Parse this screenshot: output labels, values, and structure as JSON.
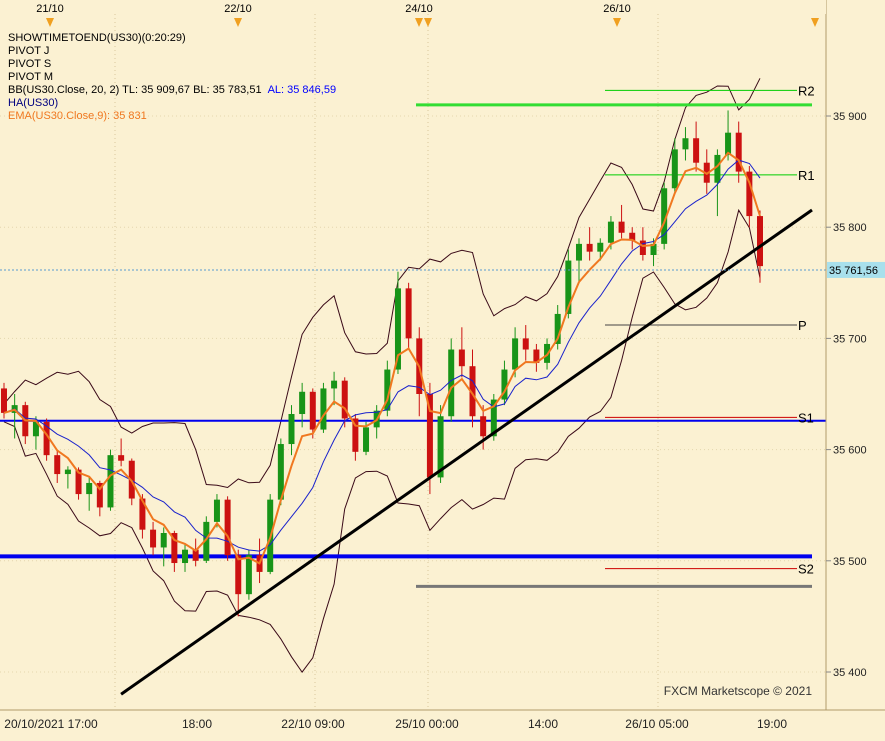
{
  "chart_data": {
    "type": "candlestick",
    "instrument": "US30",
    "top_dates": [
      "21/10",
      "22/10",
      "24/10",
      "26/10"
    ],
    "x_labels": [
      "20/10/2021 17:00",
      "18:00",
      "22/10 09:00",
      "25/10 00:00",
      "14:00",
      "26/10 05:00",
      "19:00"
    ],
    "y_ticks": [
      "35 900",
      "35 800",
      "35 700",
      "35 600",
      "35 500",
      "35 400"
    ],
    "y_tick_values": [
      35900,
      35800,
      35700,
      35600,
      35500,
      35400
    ],
    "ylim": [
      35350,
      36000
    ],
    "current_price_label": "35 761,56",
    "current_price": 35761.56,
    "legend": [
      {
        "text": "SHOWTIMETOEND(US30)(0:20:29)",
        "color": "#000000"
      },
      {
        "text": "PIVOT J",
        "color": "#000000"
      },
      {
        "text": "PIVOT S",
        "color": "#000000"
      },
      {
        "text": "PIVOT M",
        "color": "#000000"
      },
      {
        "text": "BB(US30.Close, 20, 2)  TL: 35 909,67  BL: 35 783,51",
        "extra": "AL: 35 846,59",
        "color": "#000000",
        "extra_color": "#0000ff"
      },
      {
        "text": "HA(US30)",
        "color": "#000080"
      },
      {
        "text": "EMA(US30.Close,9): 35 831",
        "color": "#f07820"
      }
    ],
    "pivot_levels": [
      {
        "label": "R2",
        "value": 35923,
        "color": "#00cc00"
      },
      {
        "label": "R1",
        "value": 35847,
        "color": "#00cc00"
      },
      {
        "label": "P",
        "value": 35712,
        "color": "#444444"
      },
      {
        "label": "S1",
        "value": 35629,
        "color": "#cc0000"
      },
      {
        "label": "S2",
        "value": 35493,
        "color": "#cc0000"
      }
    ],
    "horizontal_lines": [
      {
        "name": "resistance",
        "value": 35910,
        "color": "#33dd33"
      },
      {
        "name": "support-1",
        "value": 35626,
        "color": "#0000ee"
      },
      {
        "name": "support-2",
        "value": 35504,
        "color": "#0000ee"
      },
      {
        "name": "support-3",
        "value": 35477,
        "color": "#777777"
      }
    ],
    "trendline": {
      "start": {
        "bar": 0.14,
        "value": 35380
      },
      "end": {
        "bar": 1.0,
        "value": 35820
      }
    },
    "candles": [
      [
        35655,
        35660,
        35628,
        35633
      ],
      [
        35633,
        35650,
        35610,
        35640
      ],
      [
        35640,
        35643,
        35605,
        35612
      ],
      [
        35612,
        35630,
        35600,
        35625
      ],
      [
        35625,
        35628,
        35590,
        35595
      ],
      [
        35595,
        35600,
        35570,
        35578
      ],
      [
        35578,
        35585,
        35565,
        35582
      ],
      [
        35582,
        35584,
        35555,
        35560
      ],
      [
        35560,
        35575,
        35545,
        35570
      ],
      [
        35570,
        35572,
        35540,
        35548
      ],
      [
        35548,
        35600,
        35545,
        35595
      ],
      [
        35595,
        35610,
        35585,
        35590
      ],
      [
        35590,
        35592,
        35550,
        35556
      ],
      [
        35556,
        35560,
        35520,
        35528
      ],
      [
        35528,
        35535,
        35505,
        35512
      ],
      [
        35512,
        35530,
        35495,
        35525
      ],
      [
        35525,
        35527,
        35490,
        35498
      ],
      [
        35498,
        35515,
        35490,
        35510
      ],
      [
        35510,
        35520,
        35495,
        35500
      ],
      [
        35500,
        35540,
        35498,
        35535
      ],
      [
        35535,
        35560,
        35530,
        35555
      ],
      [
        35555,
        35558,
        35500,
        35505
      ],
      [
        35505,
        35510,
        35450,
        35470
      ],
      [
        35470,
        35510,
        35465,
        35505
      ],
      [
        35505,
        35520,
        35480,
        35490
      ],
      [
        35490,
        35560,
        35488,
        35555
      ],
      [
        35555,
        35610,
        35550,
        35605
      ],
      [
        35605,
        35640,
        35595,
        35632
      ],
      [
        35632,
        35660,
        35620,
        35652
      ],
      [
        35652,
        35655,
        35610,
        35618
      ],
      [
        35618,
        35660,
        35615,
        35655
      ],
      [
        35655,
        35670,
        35640,
        35662
      ],
      [
        35662,
        35665,
        35620,
        35628
      ],
      [
        35628,
        35632,
        35590,
        35598
      ],
      [
        35598,
        35625,
        35595,
        35620
      ],
      [
        35620,
        35640,
        35610,
        35635
      ],
      [
        35635,
        35680,
        35630,
        35672
      ],
      [
        35672,
        35760,
        35668,
        35745
      ],
      [
        35745,
        35750,
        35690,
        35700
      ],
      [
        35700,
        35710,
        35630,
        35650
      ],
      [
        35650,
        35660,
        35560,
        35575
      ],
      [
        35575,
        35640,
        35570,
        35630
      ],
      [
        35630,
        35700,
        35625,
        35690
      ],
      [
        35690,
        35710,
        35665,
        35675
      ],
      [
        35675,
        35690,
        35620,
        35630
      ],
      [
        35630,
        35640,
        35600,
        35612
      ],
      [
        35612,
        35650,
        35608,
        35645
      ],
      [
        35645,
        35680,
        35640,
        35672
      ],
      [
        35672,
        35710,
        35665,
        35700
      ],
      [
        35700,
        35712,
        35680,
        35690
      ],
      [
        35690,
        35695,
        35670,
        35678
      ],
      [
        35678,
        35700,
        35672,
        35695
      ],
      [
        35695,
        35730,
        35690,
        35722
      ],
      [
        35722,
        35780,
        35718,
        35770
      ],
      [
        35770,
        35790,
        35750,
        35785
      ],
      [
        35785,
        35800,
        35770,
        35778
      ],
      [
        35778,
        35790,
        35770,
        35786
      ],
      [
        35786,
        35810,
        35780,
        35805
      ],
      [
        35805,
        35820,
        35790,
        35795
      ],
      [
        35795,
        35800,
        35780,
        35788
      ],
      [
        35788,
        35800,
        35770,
        35775
      ],
      [
        35775,
        35790,
        35765,
        35785
      ],
      [
        35785,
        35840,
        35780,
        35835
      ],
      [
        35835,
        35880,
        35830,
        35870
      ],
      [
        35870,
        35890,
        35860,
        35880
      ],
      [
        35880,
        35895,
        35850,
        35858
      ],
      [
        35858,
        35870,
        35830,
        35840
      ],
      [
        35840,
        35870,
        35810,
        35865
      ],
      [
        35865,
        35905,
        35860,
        35885
      ],
      [
        35885,
        35895,
        35840,
        35850
      ],
      [
        35850,
        35855,
        35800,
        35810
      ],
      [
        35810,
        35815,
        35750,
        35765
      ]
    ]
  },
  "watermark": "FXCM Marketscope © 2021"
}
